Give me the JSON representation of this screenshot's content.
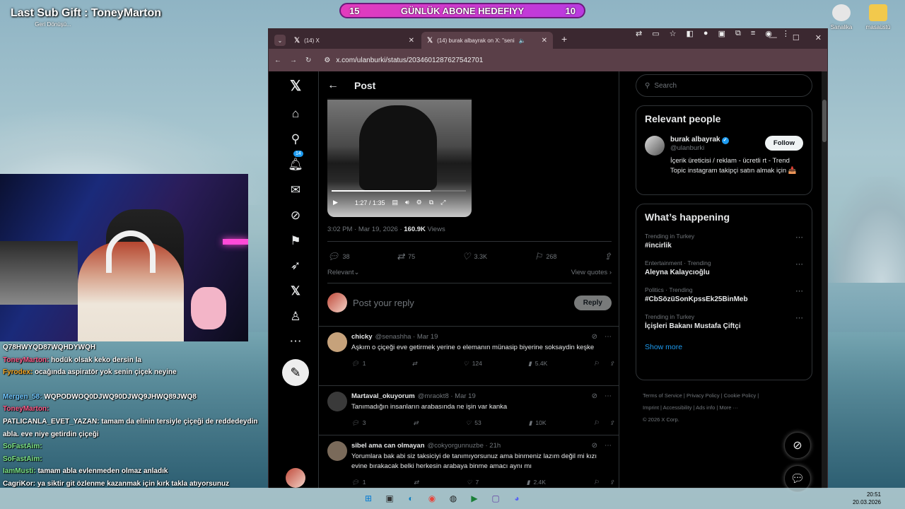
{
  "overlay": {
    "sub_gift": "Last Sub Gift : ToneyMarton",
    "goal_left": "15",
    "goal_label": "GÜNLÜK ABONE HEDEFIYY",
    "goal_right": "10"
  },
  "desktop": {
    "recycle_label": "Geri Dönüşü...",
    "icon1": "Sanalika",
    "icon2": "masaüstü"
  },
  "chat": [
    {
      "user": "",
      "msg": "Q78HWYQD87WQHDYWQH",
      "color": "#ffffff"
    },
    {
      "user": "ToneyMarton:",
      "msg": "hodük olsak keko dersin la",
      "color": "#ff5c8a"
    },
    {
      "user": "Fyrodex:",
      "msg": "ocağında aspiratör yok senin çiçek neyine",
      "color": "#f5a623"
    },
    {
      "user": "",
      "msg": "",
      "color": "#ffffff"
    },
    {
      "user": "Mergen_58:",
      "msg": "WQPODWOQ0DJWQ90DJWQ9JHWQ89JWQ8",
      "color": "#6ec6ff"
    },
    {
      "user": "ToneyMarton:",
      "msg": "",
      "color": "#ff5c8a"
    },
    {
      "user": "PATLICANLA_EVET_YAZAN:",
      "msg": "tamam da elinin tersiyle çiçeği de reddedeydin abla. eve niye getirdin çiçeği",
      "color": "#ffffff"
    },
    {
      "user": "SoFastAim:",
      "msg": "",
      "color": "#7ee787"
    },
    {
      "user": "SoFastAim:",
      "msg": "",
      "color": "#7ee787"
    },
    {
      "user": "IamMusti:",
      "msg": "tamam abla evlenmeden olmaz anladık",
      "color": "#7ee787"
    },
    {
      "user": "CagriKor:",
      "msg": "ya siktir git özlenme kazanmak için kırk takla atıyorsunuz",
      "color": "#ffffff"
    }
  ],
  "browser": {
    "tab1": "(14) X",
    "tab2": "(14) burak albayrak on X: \"seni",
    "url": "x.com/ulanburki/status/2034601287627542701"
  },
  "post": {
    "header": "Post",
    "time": "1:27 / 1:35",
    "meta_time": "3:02 PM · Mar 19, 2026 · ",
    "views_num": "160.9K",
    "views_label": " Views",
    "replies": "38",
    "reposts": "75",
    "likes": "3.3K",
    "bookmarks": "268",
    "relevant": "Relevant",
    "view_quotes": "View quotes",
    "reply_placeholder": "Post your reply",
    "reply_button": "Reply"
  },
  "nav": {
    "badge": "14"
  },
  "replies": [
    {
      "name": "chicky",
      "handle": "@senashha · Mar 19",
      "text": "Aşkım o çiçeği eve getirmek yerine o elemanın münasip biyerine soksaydin keşke",
      "c": "1",
      "l": "124",
      "v": "5.4K",
      "avatar": "#c6a27b"
    },
    {
      "name": "Martaval_okuyorum",
      "handle": "@mraokt8 · Mar 19",
      "text": "Tanımadığın insanların arabasında ne işin var kanka",
      "c": "3",
      "l": "53",
      "v": "10K",
      "avatar": "#3a3a3a"
    },
    {
      "name": "sibel ama can olmayan",
      "handle": "@cokyorgunnuzbe · 21h",
      "text": "Yorumlara bak abi siz taksiciyi de tanımıyorsunuz ama binmeniz lazım değil mi kızı evine bırakacak belki herkesin arabaya binme amacı aynı mı",
      "c": "1",
      "l": "7",
      "v": "2.4K",
      "avatar": "#7a6a5a"
    }
  ],
  "right": {
    "search": "Search",
    "relevant_title": "Relevant people",
    "person_name": "burak albayrak",
    "person_handle": "@ulanburki",
    "follow": "Follow",
    "bio": "İçerik üreticisi / reklam - ücretli rt - Trend Topic instagram takipçi satın almak için 📥",
    "happening": "What’s happening",
    "trends": [
      {
        "meta": "Trending in Turkey",
        "name": "#incirlik"
      },
      {
        "meta": "Entertainment · Trending",
        "name": "Aleyna Kalaycıoğlu"
      },
      {
        "meta": "Politics · Trending",
        "name": "#CbSözüSonKpssEk25BinMeb"
      },
      {
        "meta": "Trending in Turkey",
        "name": "İçişleri Bakanı Mustafa Çiftçi"
      }
    ],
    "show_more": "Show more",
    "footer1": "Terms of Service  |  Privacy Policy  |  Cookie Policy  |",
    "footer2": "Imprint  |  Accessibility  |  Ads info  |  More ···",
    "footer3": "© 2026 X Corp."
  },
  "clock": {
    "time": "20:51",
    "date": "20.03.2026"
  }
}
